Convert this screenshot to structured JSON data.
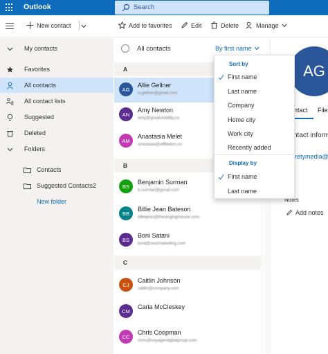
{
  "app": {
    "name": "Outlook"
  },
  "search": {
    "placeholder": "Search"
  },
  "toolbar": {
    "new_contact": "New contact",
    "add_to_favorites": "Add to favorites",
    "edit": "Edit",
    "delete": "Delete",
    "manage": "Manage"
  },
  "nav": {
    "my_contacts": "My contacts",
    "favorites": "Favorites",
    "all_contacts": "All contacts",
    "all_contact_lists": "All contact lists",
    "suggested": "Suggested",
    "deleted": "Deleted",
    "folders": "Folders",
    "contacts": "Contacts",
    "suggested_contacts2": "Suggested Contacts2",
    "new_folder": "New folder"
  },
  "list": {
    "title": "All contacts",
    "sort_label": "By first name",
    "groups": [
      "A",
      "B",
      "C"
    ],
    "contacts": [
      {
        "initials": "AG",
        "name": "Allie Gellner",
        "email": "a.gellner@gmail.com",
        "color": "#2b579a"
      },
      {
        "initials": "AN",
        "name": "Amy Newton",
        "email": "amy@greatvisibility.co",
        "color": "#5c2d91"
      },
      {
        "initials": "AM",
        "name": "Anastasia Melet",
        "email": "anastasia@affiliation.co",
        "color": "#c239b3"
      },
      {
        "initials": "BS",
        "name": "Benjamin Surman",
        "email": "b.surman@gmail.com",
        "color": "#13a10e"
      },
      {
        "initials": "BB",
        "name": "Billie Jean Bateson",
        "email": "billiejean@thesingingmouse.com",
        "color": "#038387"
      },
      {
        "initials": "BS",
        "name": "Boni Satani",
        "email": "boni@zestmarketing.com",
        "color": "#5c2d91"
      },
      {
        "initials": "CJ",
        "name": "Caitlin Johnson",
        "email": "caitlin@company.com",
        "color": "#ca5010"
      },
      {
        "initials": "CM",
        "name": "Carla McCleskey",
        "email": "carla@company.com",
        "color": "#5c2d91"
      },
      {
        "initials": "CC",
        "name": "Chris Coopman",
        "email": "chris@voyagerdigitalgroup.com",
        "color": "#c239b3"
      }
    ]
  },
  "sort_menu": {
    "sort_by_header": "Sort by",
    "sort_options": [
      "First name",
      "Last name",
      "Company",
      "Home city",
      "Work city",
      "Recently added"
    ],
    "display_by_header": "Display by",
    "display_options": [
      "First name",
      "Last name"
    ]
  },
  "detail": {
    "initials": "AG",
    "tab_contact": "ntact",
    "tab_files": "File",
    "contact_info": "ntact inform",
    "email_fragment": "retymedia@",
    "notes_label": "Notes",
    "add_notes": "Add notes"
  },
  "colors": {
    "brand": "#0f6cbd",
    "selected": "#cfe4fa"
  }
}
